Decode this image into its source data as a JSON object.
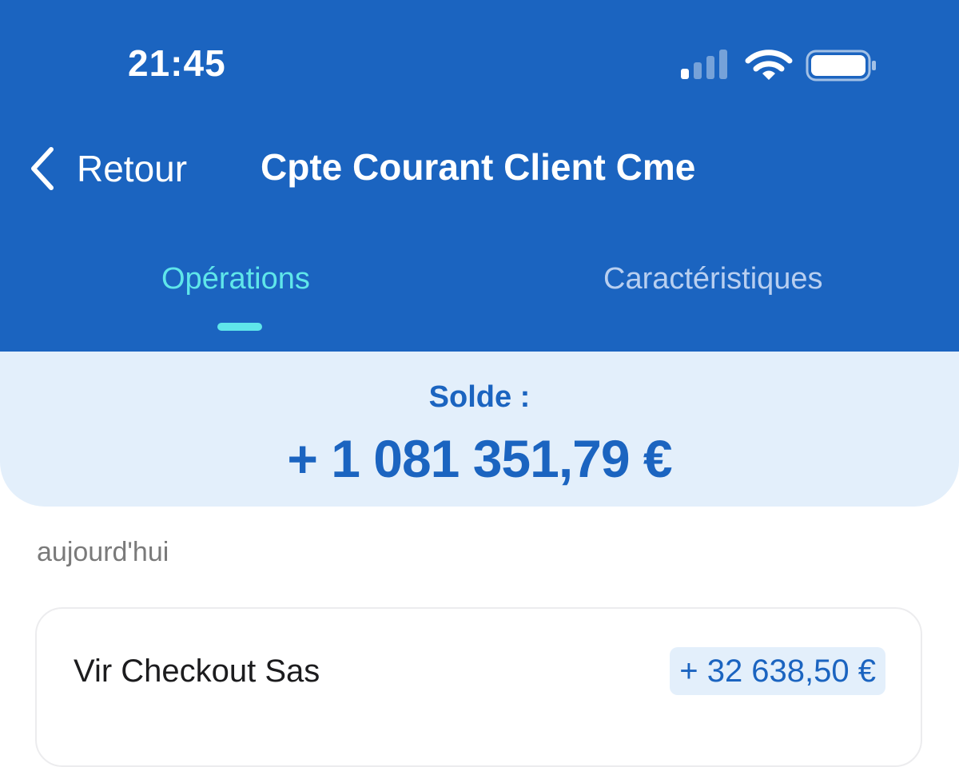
{
  "status_bar": {
    "time": "21:45",
    "icons": [
      "signal-icon",
      "wifi-icon",
      "battery-icon"
    ]
  },
  "nav": {
    "back_label": "Retour",
    "title": "Cpte Courant Client Cme"
  },
  "tabs": [
    {
      "label": "Opérations",
      "active": true
    },
    {
      "label": "Caractéristiques",
      "active": false
    }
  ],
  "balance": {
    "label": "Solde :",
    "amount": "+ 1 081 351,79 €"
  },
  "operations": {
    "date_header": "aujourd'hui",
    "items": [
      {
        "label": "Vir Checkout Sas",
        "amount": "+ 32 638,50 €"
      }
    ]
  },
  "colors": {
    "header_blue": "#1b64c0",
    "active_tab": "#5fe6ea",
    "inactive_tab": "#b8cff0",
    "balance_bg": "#e3effb",
    "amount_text": "#1b64c0"
  }
}
